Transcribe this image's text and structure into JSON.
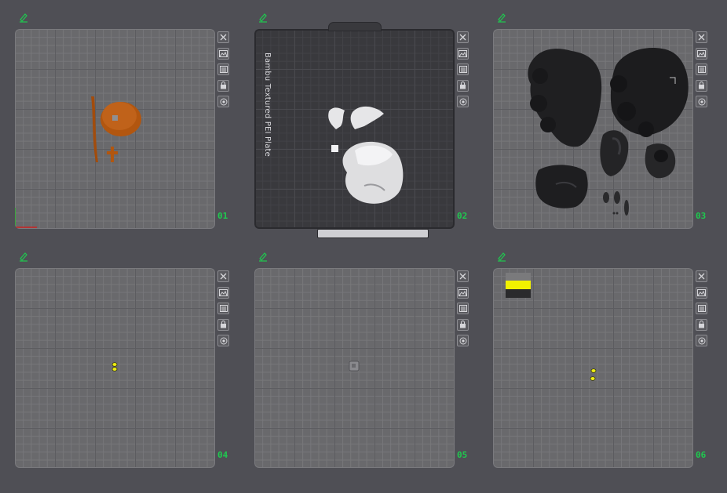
{
  "plates": [
    {
      "number": "01"
    },
    {
      "number": "02",
      "label": "Bambu Textured PEI Plate"
    },
    {
      "number": "03"
    },
    {
      "number": "04"
    },
    {
      "number": "05"
    },
    {
      "number": "06"
    }
  ],
  "colors": {
    "accent_green": "#1fc94f",
    "plate_light": "#69696c",
    "plate_dark": "#39393d",
    "filament_orange": "#b2560f",
    "filament_yellow": "#ecec12",
    "object_black": "#1c1c1e"
  },
  "icons": [
    "edit-icon",
    "close-icon",
    "image-icon",
    "list-icon",
    "lock-icon",
    "settings-icon"
  ]
}
